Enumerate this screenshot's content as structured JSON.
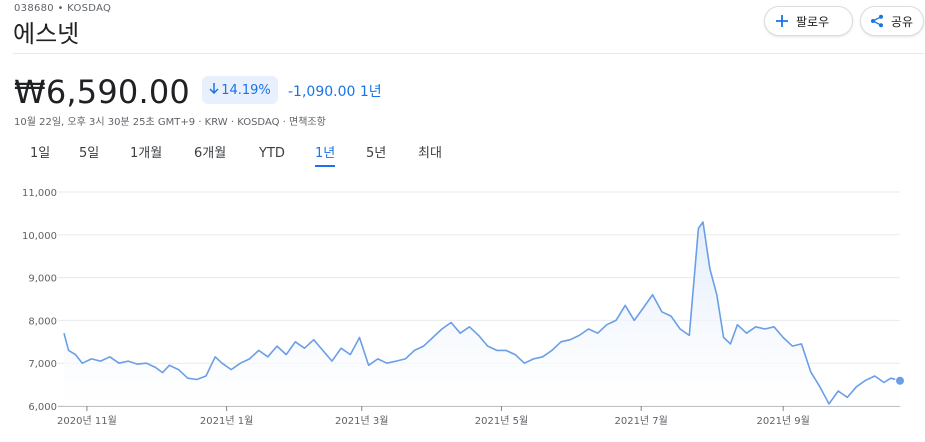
{
  "header": {
    "ticker": "038680 • KOSDAQ",
    "name": "에스넷",
    "follow_label": "팔로우",
    "share_label": "공유"
  },
  "quote": {
    "price": "₩6,590.00",
    "change_pct": "14.19%",
    "change_direction": "down",
    "change_abs": "-1,090.00 1년",
    "meta": "10월 22일, 오후 3시 30분 25초 GMT+9 · KRW · KOSDAQ · 면책조항"
  },
  "range_tabs": [
    {
      "label": "1일",
      "active": false
    },
    {
      "label": "5일",
      "active": false
    },
    {
      "label": "1개월",
      "active": false
    },
    {
      "label": "6개월",
      "active": false
    },
    {
      "label": "YTD",
      "active": false
    },
    {
      "label": "1년",
      "active": true
    },
    {
      "label": "5년",
      "active": false
    },
    {
      "label": "최대",
      "active": false
    }
  ],
  "colors": {
    "accent": "#1a73e8",
    "line": "#6b9ee6",
    "fill": "#e3edfb",
    "muted": "#5f6368"
  },
  "icons": {
    "follow": "plus-icon",
    "share": "share-icon",
    "change": "arrow-down-icon"
  },
  "chart_data": {
    "type": "area",
    "title": "",
    "xlabel": "",
    "ylabel": "",
    "ylim": [
      6000,
      11000
    ],
    "yticks": [
      "11,000",
      "10,000",
      "9,000",
      "8,000",
      "7,000",
      "6,000"
    ],
    "ytick_values": [
      11000,
      10000,
      9000,
      8000,
      7000,
      6000
    ],
    "x_range": [
      "2020-10-22",
      "2021-10-22"
    ],
    "xticks": [
      {
        "date": "2020-11-01",
        "label": "2020년 11월"
      },
      {
        "date": "2021-01-01",
        "label": "2021년 1월"
      },
      {
        "date": "2021-03-01",
        "label": "2021년 3월"
      },
      {
        "date": "2021-05-01",
        "label": "2021년 5월"
      },
      {
        "date": "2021-07-01",
        "label": "2021년 7월"
      },
      {
        "date": "2021-09-01",
        "label": "2021년 9월"
      }
    ],
    "grid": true,
    "series": [
      {
        "name": "",
        "points": [
          [
            "2020-10-22",
            7700
          ],
          [
            "2020-10-24",
            7300
          ],
          [
            "2020-10-27",
            7200
          ],
          [
            "2020-10-30",
            7000
          ],
          [
            "2020-11-03",
            7100
          ],
          [
            "2020-11-07",
            7050
          ],
          [
            "2020-11-11",
            7150
          ],
          [
            "2020-11-15",
            7000
          ],
          [
            "2020-11-19",
            7050
          ],
          [
            "2020-11-23",
            6980
          ],
          [
            "2020-11-27",
            7000
          ],
          [
            "2020-12-01",
            6900
          ],
          [
            "2020-12-04",
            6780
          ],
          [
            "2020-12-07",
            6950
          ],
          [
            "2020-12-11",
            6850
          ],
          [
            "2020-12-15",
            6650
          ],
          [
            "2020-12-19",
            6620
          ],
          [
            "2020-12-23",
            6700
          ],
          [
            "2020-12-27",
            7150
          ],
          [
            "2020-12-30",
            7000
          ],
          [
            "2021-01-03",
            6850
          ],
          [
            "2021-01-07",
            7000
          ],
          [
            "2021-01-11",
            7100
          ],
          [
            "2021-01-15",
            7300
          ],
          [
            "2021-01-19",
            7150
          ],
          [
            "2021-01-23",
            7400
          ],
          [
            "2021-01-27",
            7200
          ],
          [
            "2021-01-31",
            7500
          ],
          [
            "2021-02-04",
            7350
          ],
          [
            "2021-02-08",
            7550
          ],
          [
            "2021-02-12",
            7300
          ],
          [
            "2021-02-16",
            7050
          ],
          [
            "2021-02-20",
            7350
          ],
          [
            "2021-02-24",
            7200
          ],
          [
            "2021-02-28",
            7600
          ],
          [
            "2021-03-04",
            6950
          ],
          [
            "2021-03-08",
            7100
          ],
          [
            "2021-03-12",
            7000
          ],
          [
            "2021-03-16",
            7050
          ],
          [
            "2021-03-20",
            7100
          ],
          [
            "2021-03-24",
            7300
          ],
          [
            "2021-03-28",
            7400
          ],
          [
            "2021-04-01",
            7600
          ],
          [
            "2021-04-05",
            7800
          ],
          [
            "2021-04-09",
            7950
          ],
          [
            "2021-04-13",
            7700
          ],
          [
            "2021-04-17",
            7850
          ],
          [
            "2021-04-21",
            7650
          ],
          [
            "2021-04-25",
            7400
          ],
          [
            "2021-04-29",
            7300
          ],
          [
            "2021-05-03",
            7300
          ],
          [
            "2021-05-07",
            7200
          ],
          [
            "2021-05-11",
            7000
          ],
          [
            "2021-05-15",
            7100
          ],
          [
            "2021-05-19",
            7150
          ],
          [
            "2021-05-23",
            7300
          ],
          [
            "2021-05-27",
            7500
          ],
          [
            "2021-05-31",
            7550
          ],
          [
            "2021-06-04",
            7650
          ],
          [
            "2021-06-08",
            7800
          ],
          [
            "2021-06-12",
            7700
          ],
          [
            "2021-06-16",
            7900
          ],
          [
            "2021-06-20",
            8000
          ],
          [
            "2021-06-24",
            8350
          ],
          [
            "2021-06-28",
            8000
          ],
          [
            "2021-07-02",
            8300
          ],
          [
            "2021-07-06",
            8600
          ],
          [
            "2021-07-10",
            8200
          ],
          [
            "2021-07-14",
            8100
          ],
          [
            "2021-07-18",
            7800
          ],
          [
            "2021-07-22",
            7650
          ],
          [
            "2021-07-26",
            10150
          ],
          [
            "2021-07-28",
            10300
          ],
          [
            "2021-07-31",
            9200
          ],
          [
            "2021-08-03",
            8600
          ],
          [
            "2021-08-06",
            7600
          ],
          [
            "2021-08-09",
            7450
          ],
          [
            "2021-08-12",
            7900
          ],
          [
            "2021-08-16",
            7700
          ],
          [
            "2021-08-20",
            7850
          ],
          [
            "2021-08-24",
            7800
          ],
          [
            "2021-08-28",
            7850
          ],
          [
            "2021-09-01",
            7600
          ],
          [
            "2021-09-05",
            7400
          ],
          [
            "2021-09-09",
            7450
          ],
          [
            "2021-09-13",
            6800
          ],
          [
            "2021-09-17",
            6450
          ],
          [
            "2021-09-21",
            6050
          ],
          [
            "2021-09-25",
            6350
          ],
          [
            "2021-09-29",
            6200
          ],
          [
            "2021-10-03",
            6450
          ],
          [
            "2021-10-07",
            6600
          ],
          [
            "2021-10-11",
            6700
          ],
          [
            "2021-10-15",
            6550
          ],
          [
            "2021-10-18",
            6650
          ],
          [
            "2021-10-22",
            6590
          ]
        ]
      }
    ],
    "last_value": 6590
  }
}
